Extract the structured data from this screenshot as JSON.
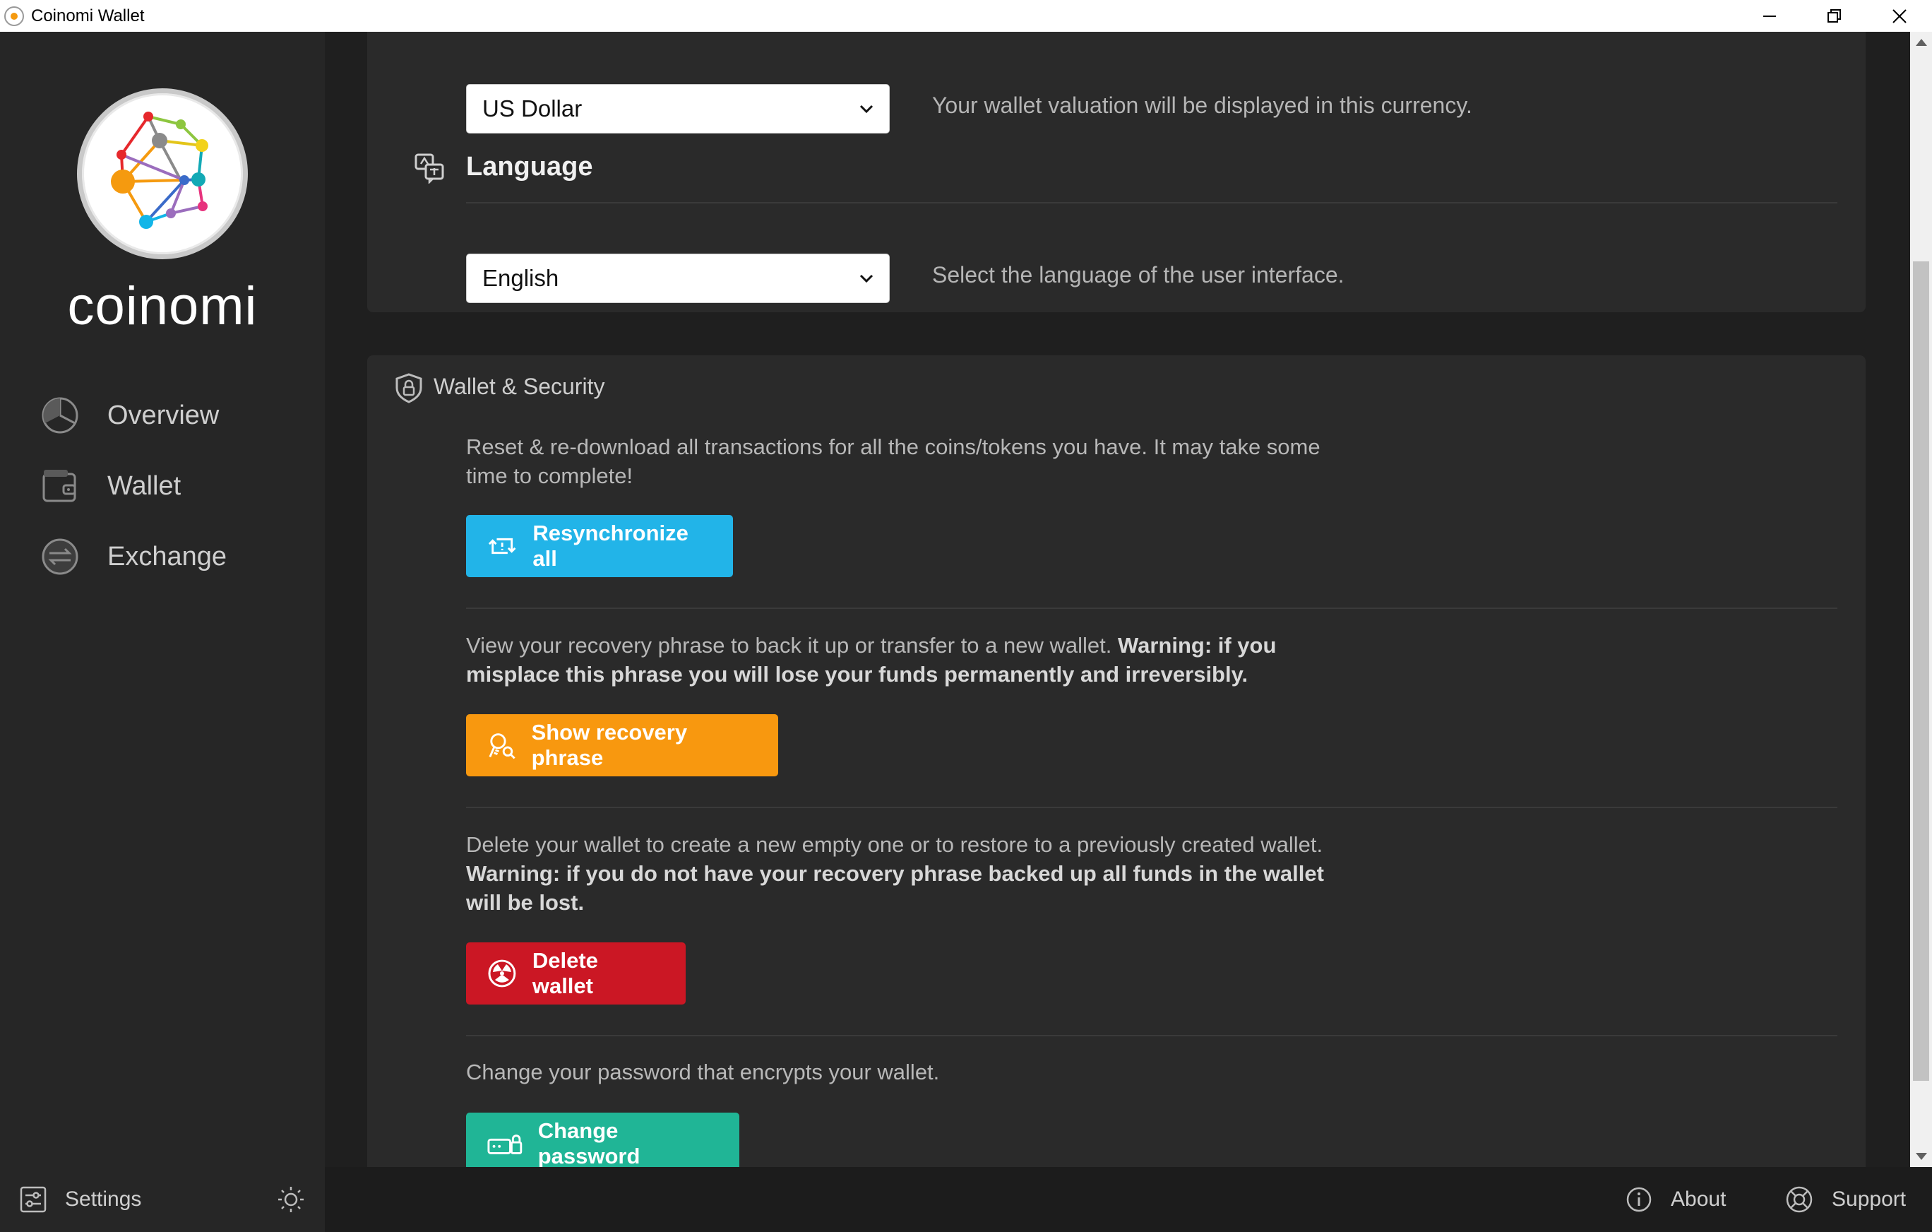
{
  "window": {
    "title": "Coinomi Wallet"
  },
  "sidebar": {
    "brand": "coinomi",
    "items": [
      {
        "label": "Overview",
        "icon": "pie-chart-icon"
      },
      {
        "label": "Wallet",
        "icon": "wallet-icon"
      },
      {
        "label": "Exchange",
        "icon": "exchange-icon"
      }
    ]
  },
  "bottom": {
    "settings_label": "Settings",
    "theme_icon": "sun-icon",
    "about_label": "About",
    "support_label": "Support"
  },
  "general": {
    "currency_value": "US Dollar",
    "currency_hint": "Your wallet valuation will be displayed in this currency.",
    "language_title": "Language",
    "language_value": "English",
    "language_hint": "Select the language of the user interface."
  },
  "security": {
    "title": "Wallet & Security",
    "resync": {
      "text": "Reset & re-download all transactions for all the coins/tokens you have. It may take some time to complete!",
      "button": "Resynchronize all"
    },
    "recovery": {
      "text": "View your recovery phrase to back it up or transfer to a new wallet. ",
      "warning": "Warning: if you misplace this phrase you will lose your funds permanently and irreversibly.",
      "button": "Show recovery phrase"
    },
    "delete": {
      "text": "Delete your wallet to create a new empty one or to restore to a previously created wallet. ",
      "warning": "Warning: if you do not have your recovery phrase backed up all funds in the wallet will be lost.",
      "button": "Delete wallet"
    },
    "password": {
      "text": "Change your password that encrypts your wallet.",
      "button": "Change password"
    }
  },
  "colors": {
    "resync": "#22b4e8",
    "recovery": "#f8980f",
    "delete": "#cb1724",
    "password": "#20b596"
  }
}
